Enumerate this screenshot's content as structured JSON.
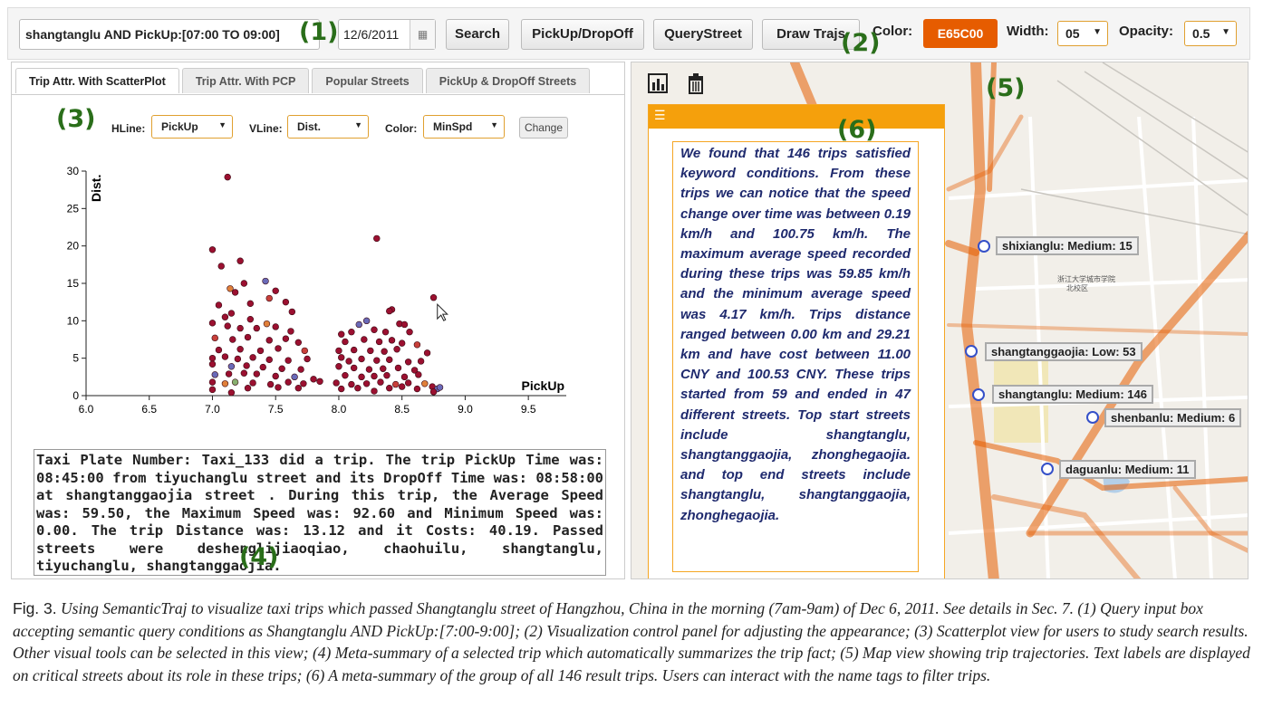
{
  "toolbar": {
    "query": "shangtanglu AND PickUp:[07:00 TO 09:00]",
    "date": "12/6/2011",
    "buttons": [
      "Search",
      "PickUp/DropOff",
      "QueryStreet",
      "Draw Trajs"
    ],
    "color_label": "Color:",
    "color_value": "E65C00",
    "width_label": "Width:",
    "width_value": "05",
    "opacity_label": "Opacity:",
    "opacity_value": "0.5"
  },
  "annotations": [
    "(1)",
    "(2)",
    "(3)",
    "(4)",
    "(5)",
    "(6)"
  ],
  "left_panel": {
    "tabs": [
      "Trip Attr. With ScatterPlot",
      "Trip Attr. With PCP",
      "Popular Streets",
      "PickUp & DropOff Streets"
    ],
    "active_tab": 0,
    "controls": {
      "hline_label": "HLine:",
      "hline_value": "PickUp",
      "vline_label": "VLine:",
      "vline_value": "Dist.",
      "color_label": "Color:",
      "color_value": "MinSpd",
      "change_label": "Change"
    },
    "trip_summary": "Taxi Plate Number: Taxi_133 did a trip. The trip PickUp Time was: 08:45:00 from tiyuchanglu street and its DropOff Time was: 08:58:00 at shangtanggaojia street . During this trip, the Average Speed was: 59.50, the Maximum Speed was: 92.60 and Minimum Speed was: 0.00. The trip Distance was: 13.12 and it Costs: 40.19. Passed streets were deshenglijiaoqiao, chaohuilu, shangtanglu, tiyuchanglu, shangtanggaojia."
  },
  "chart_data": {
    "type": "scatter",
    "xlabel": "PickUp",
    "ylabel": "Dist.",
    "xlim": [
      6.0,
      9.8
    ],
    "ylim": [
      0,
      30
    ],
    "xticks": [
      "6.0",
      "6.5",
      "7.0",
      "7.5",
      "8.0",
      "8.5",
      "9.0",
      "9.5"
    ],
    "yticks": [
      "0",
      "5",
      "10",
      "15",
      "20",
      "25",
      "30"
    ],
    "colors": {
      "dark": "#9b1030",
      "mid": "#c8403a",
      "orange": "#e0803a",
      "blue": "#6a6ab8",
      "green": "#88b070"
    },
    "points": [
      [
        7.12,
        29.2,
        "dark"
      ],
      [
        7.0,
        19.5,
        "dark"
      ],
      [
        7.22,
        18,
        "dark"
      ],
      [
        8.3,
        21,
        "dark"
      ],
      [
        7.07,
        17.3,
        "dark"
      ],
      [
        7.25,
        15,
        "dark"
      ],
      [
        7.42,
        15.3,
        "blue"
      ],
      [
        7.14,
        14.3,
        "orange"
      ],
      [
        7.18,
        13.8,
        "dark"
      ],
      [
        7.5,
        14,
        "dark"
      ],
      [
        7.45,
        13,
        "mid"
      ],
      [
        7.58,
        12.5,
        "dark"
      ],
      [
        7.05,
        12.1,
        "dark"
      ],
      [
        7.3,
        12.3,
        "dark"
      ],
      [
        8.75,
        13.1,
        "dark"
      ],
      [
        8.42,
        11.5,
        "dark"
      ],
      [
        8.4,
        11.3,
        "dark"
      ],
      [
        8.22,
        10,
        "blue"
      ],
      [
        7.63,
        11.2,
        "dark"
      ],
      [
        7.1,
        10.5,
        "dark"
      ],
      [
        7.15,
        11,
        "dark"
      ],
      [
        7.3,
        10.2,
        "dark"
      ],
      [
        7.43,
        9.6,
        "orange"
      ],
      [
        7.0,
        9.7,
        "dark"
      ],
      [
        7.12,
        9.3,
        "dark"
      ],
      [
        7.22,
        9.0,
        "dark"
      ],
      [
        7.35,
        9.0,
        "dark"
      ],
      [
        7.5,
        9.2,
        "dark"
      ],
      [
        7.62,
        8.6,
        "dark"
      ],
      [
        8.16,
        9.5,
        "blue"
      ],
      [
        8.28,
        8.8,
        "dark"
      ],
      [
        8.48,
        9.6,
        "dark"
      ],
      [
        8.52,
        9.5,
        "dark"
      ],
      [
        8.02,
        8.2,
        "dark"
      ],
      [
        8.1,
        8.5,
        "dark"
      ],
      [
        8.37,
        8.5,
        "dark"
      ],
      [
        8.56,
        8.5,
        "dark"
      ],
      [
        7.02,
        7.7,
        "mid"
      ],
      [
        7.16,
        7.5,
        "dark"
      ],
      [
        7.28,
        7.8,
        "dark"
      ],
      [
        7.45,
        7.4,
        "dark"
      ],
      [
        7.58,
        7.6,
        "dark"
      ],
      [
        7.68,
        7.1,
        "dark"
      ],
      [
        8.05,
        7.2,
        "dark"
      ],
      [
        8.2,
        7.5,
        "dark"
      ],
      [
        8.32,
        7.2,
        "dark"
      ],
      [
        8.42,
        7.4,
        "dark"
      ],
      [
        8.5,
        7.0,
        "dark"
      ],
      [
        8.62,
        6.8,
        "mid"
      ],
      [
        7.05,
        6.1,
        "dark"
      ],
      [
        7.22,
        6.2,
        "dark"
      ],
      [
        7.38,
        6.0,
        "dark"
      ],
      [
        7.52,
        6.3,
        "dark"
      ],
      [
        7.73,
        6.0,
        "mid"
      ],
      [
        8.0,
        6.0,
        "dark"
      ],
      [
        8.12,
        6.1,
        "dark"
      ],
      [
        8.25,
        6.0,
        "dark"
      ],
      [
        8.36,
        5.9,
        "dark"
      ],
      [
        8.46,
        6.2,
        "dark"
      ],
      [
        8.7,
        5.7,
        "dark"
      ],
      [
        7.0,
        5.0,
        "dark"
      ],
      [
        7.1,
        5.2,
        "dark"
      ],
      [
        7.2,
        4.9,
        "dark"
      ],
      [
        7.32,
        5.1,
        "dark"
      ],
      [
        7.45,
        4.8,
        "dark"
      ],
      [
        7.6,
        4.7,
        "dark"
      ],
      [
        7.75,
        4.9,
        "dark"
      ],
      [
        8.02,
        5.1,
        "dark"
      ],
      [
        8.08,
        4.6,
        "dark"
      ],
      [
        8.18,
        4.9,
        "dark"
      ],
      [
        8.3,
        4.7,
        "dark"
      ],
      [
        8.4,
        4.8,
        "dark"
      ],
      [
        8.55,
        4.5,
        "dark"
      ],
      [
        8.65,
        4.6,
        "dark"
      ],
      [
        7.0,
        4.2,
        "dark"
      ],
      [
        7.15,
        3.9,
        "blue"
      ],
      [
        7.27,
        4.0,
        "dark"
      ],
      [
        7.4,
        3.8,
        "dark"
      ],
      [
        7.55,
        3.6,
        "dark"
      ],
      [
        7.7,
        3.5,
        "dark"
      ],
      [
        8.0,
        3.9,
        "dark"
      ],
      [
        8.12,
        3.7,
        "dark"
      ],
      [
        8.24,
        3.5,
        "dark"
      ],
      [
        8.35,
        3.6,
        "dark"
      ],
      [
        8.47,
        3.7,
        "dark"
      ],
      [
        8.6,
        3.4,
        "dark"
      ],
      [
        7.02,
        2.8,
        "blue"
      ],
      [
        7.13,
        2.9,
        "dark"
      ],
      [
        7.25,
        3.0,
        "dark"
      ],
      [
        7.35,
        2.9,
        "dark"
      ],
      [
        7.5,
        2.6,
        "dark"
      ],
      [
        7.65,
        2.5,
        "blue"
      ],
      [
        7.8,
        2.2,
        "dark"
      ],
      [
        8.05,
        2.7,
        "dark"
      ],
      [
        8.18,
        2.5,
        "dark"
      ],
      [
        8.28,
        2.6,
        "dark"
      ],
      [
        8.38,
        2.7,
        "dark"
      ],
      [
        8.52,
        2.5,
        "dark"
      ],
      [
        8.63,
        2.8,
        "dark"
      ],
      [
        7.0,
        1.8,
        "dark"
      ],
      [
        7.1,
        1.6,
        "orange"
      ],
      [
        7.18,
        1.8,
        "green"
      ],
      [
        7.32,
        1.7,
        "dark"
      ],
      [
        7.46,
        1.5,
        "dark"
      ],
      [
        7.6,
        1.8,
        "dark"
      ],
      [
        7.72,
        1.6,
        "dark"
      ],
      [
        7.85,
        1.9,
        "dark"
      ],
      [
        7.98,
        1.7,
        "dark"
      ],
      [
        8.1,
        1.5,
        "dark"
      ],
      [
        8.22,
        1.6,
        "dark"
      ],
      [
        8.33,
        1.8,
        "dark"
      ],
      [
        8.45,
        1.5,
        "mid"
      ],
      [
        8.55,
        1.7,
        "dark"
      ],
      [
        8.68,
        1.6,
        "orange"
      ],
      [
        8.74,
        1.2,
        "dark"
      ],
      [
        8.78,
        0.9,
        "blue"
      ],
      [
        8.8,
        1.1,
        "blue"
      ],
      [
        7.0,
        0.8,
        "dark"
      ],
      [
        7.15,
        0.4,
        "dark"
      ],
      [
        7.28,
        1.0,
        "dark"
      ],
      [
        7.52,
        1.1,
        "dark"
      ],
      [
        7.68,
        1.0,
        "dark"
      ],
      [
        8.02,
        0.9,
        "dark"
      ],
      [
        8.15,
        1.0,
        "dark"
      ],
      [
        8.28,
        0.6,
        "dark"
      ],
      [
        8.4,
        1.0,
        "dark"
      ],
      [
        8.5,
        1.2,
        "dark"
      ],
      [
        8.62,
        0.9,
        "dark"
      ],
      [
        8.75,
        0.5,
        "dark"
      ]
    ]
  },
  "right_panel": {
    "group_summary": "We found that 146 trips satisfied keyword conditions. From these trips we can notice that the speed change over time was between 0.19 km/h and 100.75 km/h. The maximum average speed recorded during these trips was 59.85 km/h and the minimum average speed was 4.17 km/h. Trips distance ranged between 0.00 km and 29.21 km and have cost between 11.00 CNY and 100.53 CNY. These trips started from 59 and ended in 47 different streets. Top start streets include shangtanglu, shangtanggaojia, zhonghegaojia. and top end streets include shangtanglu, shangtanggaojia, zhonghegaojia.",
    "street_tags": [
      "shixianglu: Medium: 15",
      "shangtanggaojia: Low: 53",
      "shangtanglu: Medium: 146",
      "shenbanlu: Medium: 6",
      "daguanlu: Medium: 11"
    ],
    "map_labels": [
      "浙江大学城市学院",
      "北校区"
    ]
  },
  "caption": {
    "fig": "Fig. 3.",
    "text": "Using SemanticTraj to visualize taxi trips which passed Shangtanglu street of Hangzhou, China in the morning (7am-9am) of Dec 6, 2011. See details in Sec. 7. (1) Query input box accepting semantic query conditions as Shangtanglu AND PickUp:[7:00-9:00]; (2) Visualization control panel for adjusting the appearance; (3) Scatterplot view for users to study search results. Other visual tools can be selected in this view; (4) Meta-summary of a selected trip which automatically summarizes the trip fact; (5) Map view showing trip trajectories. Text labels are displayed on critical streets about its role in these trips; (6) A meta-summary of the group of all 146 result trips. Users can interact with the name tags to filter trips."
  }
}
